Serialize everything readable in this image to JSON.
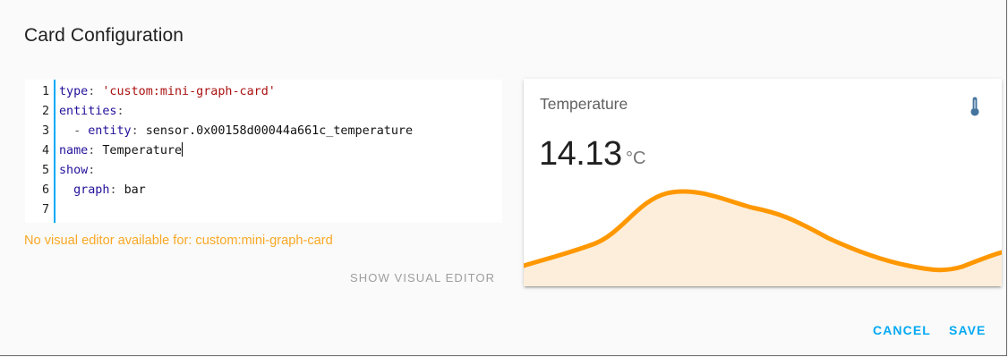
{
  "dialog": {
    "title": "Card Configuration",
    "warning": "No visual editor available for: custom:mini-graph-card",
    "show_visual_editor_label": "SHOW VISUAL EDITOR",
    "cancel_label": "CANCEL",
    "save_label": "SAVE"
  },
  "editor": {
    "line_numbers": [
      "1",
      "2",
      "3",
      "4",
      "5",
      "6",
      "7"
    ],
    "lines": [
      {
        "key": "type",
        "sep": ": ",
        "value": "'custom:mini-graph-card'",
        "value_kind": "string",
        "indent": ""
      },
      {
        "key": "entities",
        "sep": ":",
        "value": "",
        "value_kind": "plain",
        "indent": ""
      },
      {
        "key": "entity",
        "sep": ": ",
        "value": "sensor.0x00158d00044a661c_temperature",
        "value_kind": "plain",
        "indent": "  - "
      },
      {
        "key": "name",
        "sep": ": ",
        "value": "Temperature",
        "value_kind": "plain",
        "indent": ""
      },
      {
        "key": "show",
        "sep": ":",
        "value": "",
        "value_kind": "plain",
        "indent": ""
      },
      {
        "key": "graph",
        "sep": ": ",
        "value": "bar",
        "value_kind": "plain",
        "indent": "  "
      },
      {
        "key": "",
        "sep": "",
        "value": "",
        "value_kind": "plain",
        "indent": ""
      }
    ],
    "accent_color": "#03a9f4"
  },
  "preview": {
    "name": "Temperature",
    "state": "14.13",
    "unit": "°C",
    "icon": "thermometer-icon",
    "line_color": "#ff9800",
    "fill_color": "#fdeedb"
  },
  "colors": {
    "primary": "#03a9f4",
    "warning": "#f9a825"
  }
}
